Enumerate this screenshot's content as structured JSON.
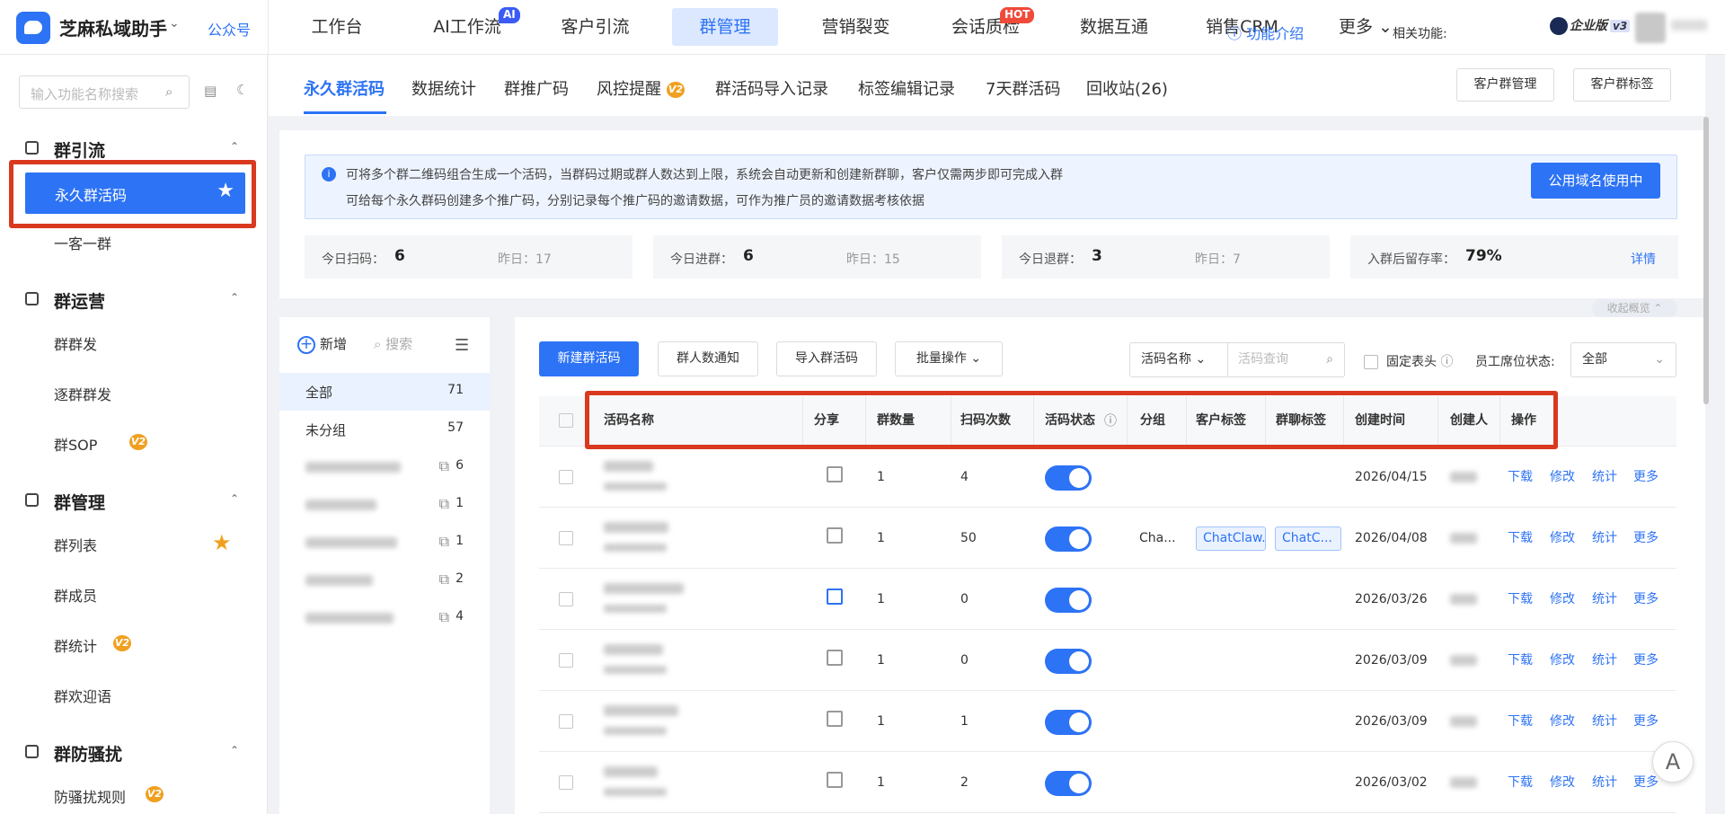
{
  "app": {
    "name": "芝麻私域助手",
    "gzh": "公众号"
  },
  "topnav": [
    {
      "label": "工作台"
    },
    {
      "label": "AI工作流",
      "badge": "AI"
    },
    {
      "label": "客户引流"
    },
    {
      "label": "群管理",
      "active": true
    },
    {
      "label": "营销裂变"
    },
    {
      "label": "会话质检",
      "badge": "HOT"
    },
    {
      "label": "数据互通"
    },
    {
      "label": "销售CRM"
    },
    {
      "label": "更多 ⌄"
    }
  ],
  "edition": {
    "label": "企业版",
    "version": "v3"
  },
  "sidebar": {
    "search_placeholder": "输入功能名称搜索",
    "groups": [
      {
        "title": "群引流",
        "items": [
          {
            "label": "永久群活码",
            "active": true
          },
          {
            "label": "一客一群"
          }
        ]
      },
      {
        "title": "群运营",
        "items": [
          {
            "label": "群群发"
          },
          {
            "label": "逐群群发"
          },
          {
            "label": "群SOP",
            "badge": "V2"
          }
        ]
      },
      {
        "title": "群管理",
        "items": [
          {
            "label": "群列表",
            "star": true
          },
          {
            "label": "群成员"
          },
          {
            "label": "群统计",
            "badge": "V2"
          },
          {
            "label": "群欢迎语"
          }
        ]
      },
      {
        "title": "群防骚扰",
        "items": [
          {
            "label": "防骚扰规则",
            "badge": "V2"
          }
        ]
      }
    ]
  },
  "tabs": [
    {
      "label": "永久群活码",
      "active": true
    },
    {
      "label": "数据统计"
    },
    {
      "label": "群推广码"
    },
    {
      "label": "风控提醒",
      "badge": "V2"
    },
    {
      "label": "群活码导入记录"
    },
    {
      "label": "标签编辑记录"
    },
    {
      "label": "7天群活码"
    },
    {
      "label": "回收站(26)"
    }
  ],
  "func_intro": "功能介绍",
  "related": {
    "label": "相关功能:",
    "buttons": [
      "客户群管理",
      "客户群标签"
    ]
  },
  "info": {
    "line1": "可将多个群二维码组合生成一个活码，当群码过期或群人数达到上限，系统会自动更新和创建新群聊，客户仅需两步即可完成入群",
    "line2": "可给每个永久群码创建多个推广码，分别记录每个推广码的邀请数据，可作为推广员的邀请数据考核依据",
    "domain_button": "公用域名使用中"
  },
  "stats": [
    {
      "label": "今日扫码：",
      "value": "6",
      "yesterday": "昨日：17"
    },
    {
      "label": "今日进群：",
      "value": "6",
      "yesterday": "昨日：15"
    },
    {
      "label": "今日退群：",
      "value": "3",
      "yesterday": "昨日：7"
    },
    {
      "label": "入群后留存率：",
      "value": "79%",
      "detail": "详情"
    }
  ],
  "collapse_label": "收起概览 ⌃",
  "grouplist": {
    "add_label": "新增",
    "search_label": "搜索",
    "items": [
      {
        "name": "全部",
        "count": "71",
        "active": true
      },
      {
        "name": "未分组",
        "count": "57"
      },
      {
        "count": "6",
        "blurred": true
      },
      {
        "count": "1",
        "blurred": true
      },
      {
        "count": "1",
        "blurred": true
      },
      {
        "count": "2",
        "blurred": true
      },
      {
        "count": "4",
        "blurred": true
      }
    ]
  },
  "toolbar": {
    "new_button": "新建群活码",
    "notify_button": "群人数通知",
    "import_button": "导入群活码",
    "batch_button": "批量操作 ⌄",
    "filter_select": "活码名称 ⌄",
    "filter_placeholder": "活码查询",
    "fixed_header": "固定表头",
    "seat_label": "员工席位状态:",
    "seat_value": "全部"
  },
  "table": {
    "headers": [
      "活码名称",
      "分享",
      "群数量",
      "扫码次数",
      "活码状态",
      "分组",
      "客户标签",
      "群聊标签",
      "创建时间",
      "创建人",
      "操作"
    ],
    "rows": [
      {
        "groups": "1",
        "scans": "4",
        "group_name": "",
        "cust_tag": "",
        "chat_tag": "",
        "date": "2026/04/15"
      },
      {
        "groups": "1",
        "scans": "50",
        "group_name": "Cha...",
        "cust_tag": "ChatClaw.",
        "chat_tag": "ChatC...",
        "date": "2026/04/08"
      },
      {
        "groups": "1",
        "scans": "0",
        "group_name": "",
        "cust_tag": "",
        "chat_tag": "",
        "date": "2026/03/26",
        "share_active": true
      },
      {
        "groups": "1",
        "scans": "0",
        "group_name": "",
        "cust_tag": "",
        "chat_tag": "",
        "date": "2026/03/09"
      },
      {
        "groups": "1",
        "scans": "1",
        "group_name": "",
        "cust_tag": "",
        "chat_tag": "",
        "date": "2026/03/09"
      },
      {
        "groups": "1",
        "scans": "2",
        "group_name": "",
        "cust_tag": "",
        "chat_tag": "",
        "date": "2026/03/02"
      }
    ],
    "actions": [
      "下载",
      "修改",
      "统计",
      "更多"
    ]
  },
  "colors": {
    "accent": "#2d73f5",
    "highlight_box": "#d9391f",
    "v2_badge": "#f0a020",
    "hot_badge": "#f04a3a",
    "ai_badge": "#3a5cf5"
  }
}
